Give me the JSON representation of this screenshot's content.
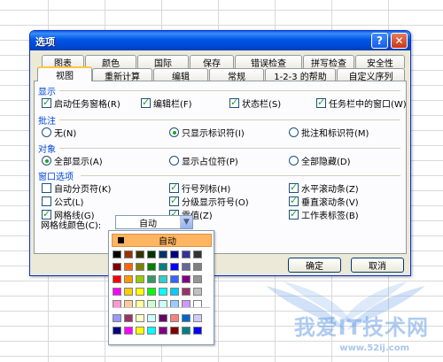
{
  "watermark": {
    "text": "我爱IT技术网",
    "url": "www.52ij.com"
  },
  "dialog": {
    "title": "选项",
    "help_glyph": "?",
    "close_glyph": "✕",
    "tabs_row1": [
      "图表",
      "颜色",
      "国际",
      "保存",
      "错误检查",
      "拼写检查",
      "安全性"
    ],
    "tabs_row2": [
      "视图",
      "重新计算",
      "编辑",
      "常规",
      "1-2-3 的帮助",
      "自定义序列"
    ],
    "active_tab": "视图",
    "sections": {
      "display": {
        "title": "显示",
        "options": [
          {
            "label": "启动任务窗格(R)",
            "checked": true
          },
          {
            "label": "编辑栏(F)",
            "checked": true
          },
          {
            "label": "状态栏(S)",
            "checked": true
          },
          {
            "label": "任务栏中的窗口(W)",
            "checked": true
          }
        ]
      },
      "comments": {
        "title": "批注",
        "options": [
          {
            "label": "无(N)",
            "selected": false
          },
          {
            "label": "只显示标识符(I)",
            "selected": true
          },
          {
            "label": "批注和标识符(M)",
            "selected": false
          }
        ]
      },
      "objects": {
        "title": "对象",
        "options": [
          {
            "label": "全部显示(A)",
            "selected": true
          },
          {
            "label": "显示占位符(P)",
            "selected": false
          },
          {
            "label": "全部隐藏(D)",
            "selected": false
          }
        ]
      },
      "window": {
        "title": "窗口选项",
        "options": [
          {
            "label": "自动分页符(K)",
            "checked": false
          },
          {
            "label": "行号列标(H)",
            "checked": true
          },
          {
            "label": "水平滚动条(Z)",
            "checked": true
          },
          {
            "label": "公式(L)",
            "checked": false
          },
          {
            "label": "分级显示符号(O)",
            "checked": true
          },
          {
            "label": "垂直滚动条(V)",
            "checked": true
          },
          {
            "label": "网格线(G)",
            "checked": true
          },
          {
            "label": "零值(Z)",
            "checked": true
          },
          {
            "label": "工作表标签(B)",
            "checked": true
          }
        ]
      }
    },
    "gridline_color": {
      "label": "网格线颜色(C):",
      "value": "自动"
    },
    "ok_label": "确定",
    "cancel_label": "取消"
  },
  "palette": {
    "auto_label": "自动",
    "rows": [
      [
        "#000000",
        "#993300",
        "#333300",
        "#003300",
        "#003366",
        "#000080",
        "#333399",
        "#333333"
      ],
      [
        "#800000",
        "#ff6600",
        "#808000",
        "#008000",
        "#008080",
        "#0000ff",
        "#666699",
        "#808080"
      ],
      [
        "#ff0000",
        "#ff9900",
        "#99cc00",
        "#339966",
        "#33cccc",
        "#3366ff",
        "#800080",
        "#969696"
      ],
      [
        "#ff00ff",
        "#ffcc00",
        "#ffff00",
        "#00ff00",
        "#00ffff",
        "#00ccff",
        "#993366",
        "#c0c0c0"
      ],
      [
        "#ff99cc",
        "#ffcc99",
        "#ffff99",
        "#ccffcc",
        "#ccffff",
        "#99ccff",
        "#cc99ff",
        "#ffffff"
      ]
    ],
    "lower_rows": [
      [
        "#9999ff",
        "#993366",
        "#ffffcc",
        "#ccffff",
        "#660066",
        "#ff8080",
        "#0066cc",
        "#ccccff"
      ],
      [
        "#000080",
        "#ff00ff",
        "#ffff00",
        "#00ffff",
        "#800080",
        "#800000",
        "#008080",
        "#0000ff"
      ]
    ]
  }
}
